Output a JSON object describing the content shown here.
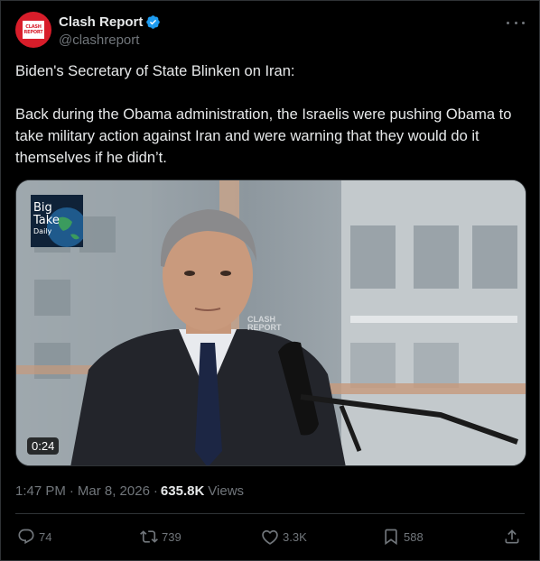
{
  "author": {
    "display_name": "Clash Report",
    "handle": "@clashreport",
    "avatar_text_line1": "CLASH",
    "avatar_text_line2": "REPORT",
    "verified_color": "#1d9bf0"
  },
  "post": {
    "paragraphs": [
      "Biden's Secretary of State Blinken on Iran:",
      "Back during the Obama administration, the Israelis were pushing Obama to take military action against Iran and were warning that they would do it themselves if he didn’t."
    ]
  },
  "media": {
    "duration": "0:24",
    "badge_line1": "Big",
    "badge_line2": "Take",
    "badge_line3": "Daily",
    "watermark_line1": "CLASH",
    "watermark_line2": "REPORT"
  },
  "meta": {
    "time": "1:47 PM",
    "separator": "·",
    "date": "Mar 8, 2026",
    "views_count": "635.8K",
    "views_label": "Views"
  },
  "actions": {
    "replies": "74",
    "reposts": "739",
    "likes": "3.3K",
    "bookmarks": "588"
  },
  "colors": {
    "background": "#000000",
    "text_primary": "#e7e9ea",
    "text_secondary": "#71767b",
    "border": "#2f3336",
    "brand_red": "#d81d2a"
  }
}
